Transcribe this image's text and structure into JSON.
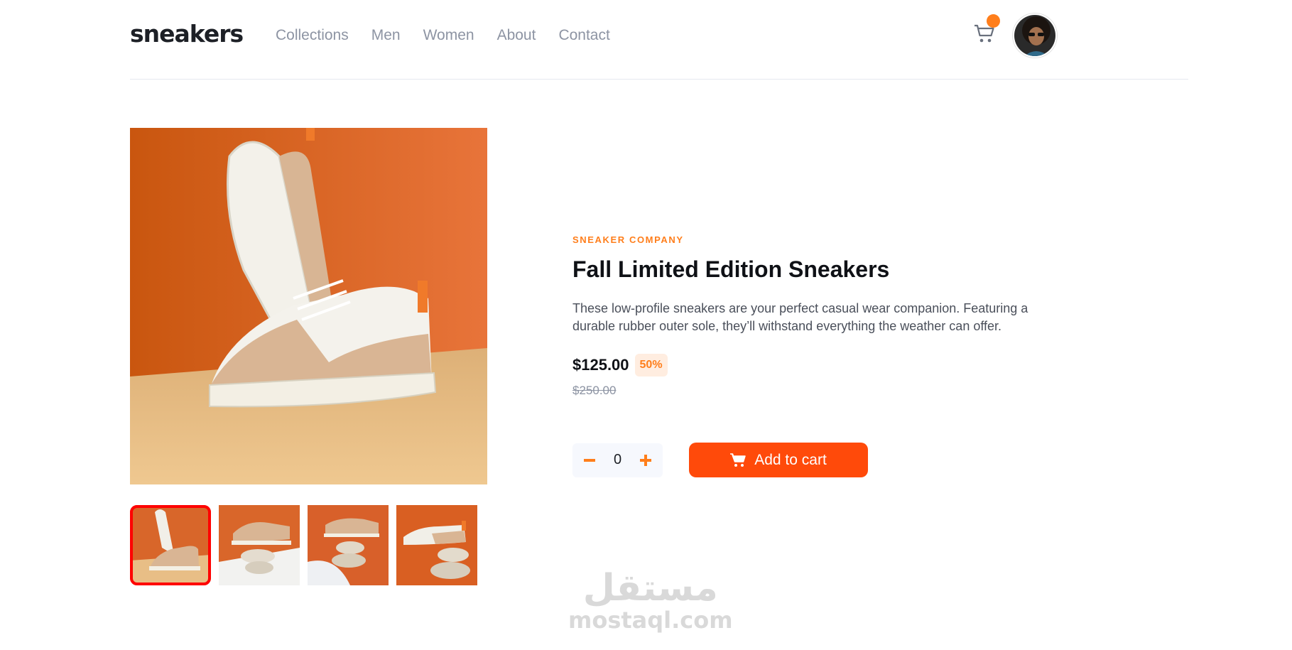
{
  "header": {
    "logo": "sneakers",
    "nav": [
      "Collections",
      "Men",
      "Women",
      "About",
      "Contact"
    ],
    "cart_icon": "cart-icon",
    "avatar_icon": "avatar"
  },
  "gallery": {
    "thumbnails": [
      "thumbnail-1",
      "thumbnail-2",
      "thumbnail-3",
      "thumbnail-4"
    ],
    "active_index": 0
  },
  "product": {
    "company": "SNEAKER COMPANY",
    "title": "Fall Limited Edition Sneakers",
    "description": "These low-profile sneakers are your perfect casual wear companion. Featuring a durable rubber outer sole, they’ll withstand everything the weather can offer.",
    "price": "$125.00",
    "discount": "50%",
    "old_price": "$250.00"
  },
  "cart_controls": {
    "quantity": "0",
    "add_label": "Add to cart"
  },
  "watermark": {
    "arabic": "مستقل",
    "latin": "mostaql.com"
  },
  "colors": {
    "accent": "#ff7e1b",
    "button": "#ff4a0a",
    "active_thumb_border": "#ff0000"
  }
}
